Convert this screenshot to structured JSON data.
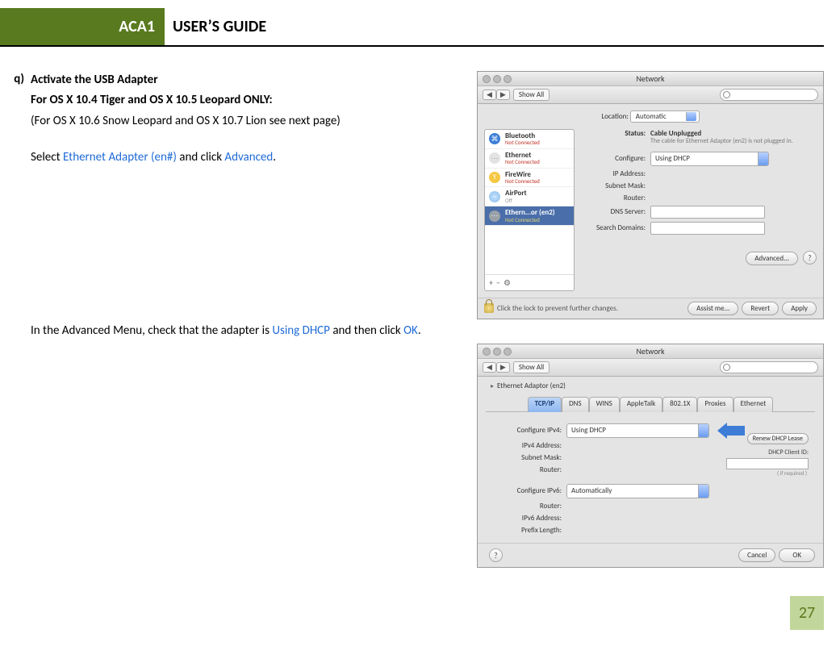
{
  "header": {
    "badge": "ACA1",
    "title": "USER’S GUIDE"
  },
  "step_marker": "q)",
  "text": {
    "line1_bold": "Activate the USB Adapter",
    "line2_bold": "For OS X 10.4 Tiger and OS X 10.5 Leopard ONLY:",
    "line3": "(For OS X 10.6 Snow Leopard and OS X 10.7 Lion see next page)",
    "line4_a": "Select ",
    "line4_link1": "Ethernet Adapter (en#)",
    "line4_b": " and click ",
    "line4_link2": "Advanced",
    "line4_c": ".",
    "line5_a": "In the Advanced Menu, check that the adapter is ",
    "line5_link1": "Using DHCP",
    "line5_b": " and then click ",
    "line5_link2": "OK",
    "line5_c": "."
  },
  "panel1": {
    "window_title": "Network",
    "show_all": "Show All",
    "location_label": "Location:",
    "location_value": "Automatic",
    "sidebar": [
      {
        "title": "Bluetooth",
        "sub": "Not Connected",
        "sub_class": "",
        "icon": "ic-bt",
        "glyph": "⌘"
      },
      {
        "title": "Ethernet",
        "sub": "Not Connected",
        "sub_class": "",
        "icon": "ic-eth",
        "glyph": "⋯"
      },
      {
        "title": "FireWire",
        "sub": "Not Connected",
        "sub_class": "",
        "icon": "ic-fw",
        "glyph": "Y"
      },
      {
        "title": "AirPort",
        "sub": "Off",
        "sub_class": "grey",
        "icon": "ic-ap",
        "glyph": "⌢"
      },
      {
        "title": "Ethern...or (en2)",
        "sub": "Not Connected",
        "sub_class": "",
        "icon": "ic-en",
        "glyph": "⋯",
        "selected": true
      }
    ],
    "tools": {
      "plus": "+",
      "minus": "−",
      "gear": "⚙︎"
    },
    "status_label": "Status:",
    "status_value": "Cable Unplugged",
    "status_desc": "The cable for Ethernet Adaptor (en2) is not plugged in.",
    "fields": {
      "configure": {
        "label": "Configure:",
        "value": "Using DHCP"
      },
      "ip": {
        "label": "IP Address:"
      },
      "mask": {
        "label": "Subnet Mask:"
      },
      "router": {
        "label": "Router:"
      },
      "dns": {
        "label": "DNS Server:"
      },
      "search": {
        "label": "Search Domains:"
      }
    },
    "advanced_btn": "Advanced...",
    "help": "?",
    "lock_text": "Click the lock to prevent further changes.",
    "footer_buttons": {
      "assist": "Assist me...",
      "revert": "Revert",
      "apply": "Apply"
    }
  },
  "panel2": {
    "window_title": "Network",
    "show_all": "Show All",
    "crumb": "Ethernet Adaptor (en2)",
    "tabs": [
      "TCP/IP",
      "DNS",
      "WINS",
      "AppleTalk",
      "802.1X",
      "Proxies",
      "Ethernet"
    ],
    "active_tab": 0,
    "fields": {
      "cfg4": {
        "label": "Configure IPv4:",
        "value": "Using DHCP"
      },
      "ipv4": {
        "label": "IPv4 Address:"
      },
      "mask": {
        "label": "Subnet Mask:"
      },
      "router": {
        "label": "Router:"
      },
      "cfg6": {
        "label": "Configure IPv6:",
        "value": "Automatically"
      },
      "router6": {
        "label": "Router:"
      },
      "ipv6": {
        "label": "IPv6 Address:"
      },
      "plen": {
        "label": "Prefix Length:"
      }
    },
    "renew_btn": "Renew DHCP Lease",
    "client_id_label": "DHCP Client ID:",
    "if_required": "( if required )",
    "help": "?",
    "footer_buttons": {
      "cancel": "Cancel",
      "ok": "OK"
    }
  },
  "page_number": "27"
}
